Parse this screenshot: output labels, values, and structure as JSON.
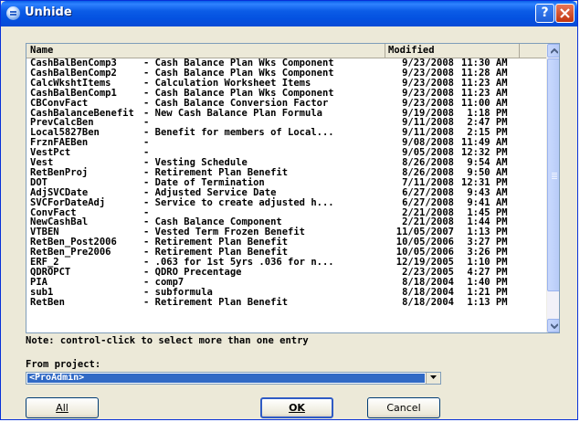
{
  "window": {
    "title": "Unhide",
    "help_label": "?",
    "close_label": "X"
  },
  "table": {
    "columns": [
      "Name",
      "Modified"
    ],
    "rows": [
      {
        "name": "CashBalBenComp3",
        "desc": "- Cash Balance Plan Wks Component",
        "date": "9/23/2008",
        "time": "11:30 AM"
      },
      {
        "name": "CashBalBenComp2",
        "desc": "- Cash Balance Plan Wks Component",
        "date": "9/23/2008",
        "time": "11:28 AM"
      },
      {
        "name": "CalcWkshtItems",
        "desc": "- Calculation Worksheet Items",
        "date": "9/23/2008",
        "time": "11:23 AM"
      },
      {
        "name": "CashBalBenComp1",
        "desc": "- Cash Balance Plan Wks Component",
        "date": "9/23/2008",
        "time": "11:23 AM"
      },
      {
        "name": "CBConvFact",
        "desc": "- Cash Balance Conversion Factor",
        "date": "9/23/2008",
        "time": "11:00 AM"
      },
      {
        "name": "CashBalanceBenefit",
        "desc": "- New Cash Balance Plan Formula",
        "date": "9/19/2008",
        "time": " 1:18 PM"
      },
      {
        "name": "PrevCalcBen",
        "desc": "-",
        "date": "9/11/2008",
        "time": " 2:47 PM"
      },
      {
        "name": "Local5827Ben",
        "desc": "- Benefit for members of Local...",
        "date": "9/11/2008",
        "time": " 2:15 PM"
      },
      {
        "name": "FrznFAEBen",
        "desc": "-",
        "date": "9/08/2008",
        "time": "11:49 AM"
      },
      {
        "name": "VestPct",
        "desc": "-",
        "date": "9/05/2008",
        "time": "12:32 PM"
      },
      {
        "name": "Vest",
        "desc": "- Vesting Schedule",
        "date": "8/26/2008",
        "time": " 9:54 AM"
      },
      {
        "name": "RetBenProj",
        "desc": "- Retirement Plan Benefit",
        "date": "8/26/2008",
        "time": " 9:50 AM"
      },
      {
        "name": "DOT",
        "desc": "- Date of Termination",
        "date": "7/11/2008",
        "time": "12:31 PM"
      },
      {
        "name": "AdjSVCDate",
        "desc": "- Adjusted Service Date",
        "date": "6/27/2008",
        "time": " 9:43 AM"
      },
      {
        "name": "SVCForDateAdj",
        "desc": "- Service to create adjusted h...",
        "date": "6/27/2008",
        "time": " 9:41 AM"
      },
      {
        "name": "ConvFact",
        "desc": "-",
        "date": "2/21/2008",
        "time": " 1:45 PM"
      },
      {
        "name": "NewCashBal",
        "desc": "- Cash Balance Component",
        "date": "2/21/2008",
        "time": " 1:44 PM"
      },
      {
        "name": "VTBEN",
        "desc": "- Vested Term Frozen Benefit",
        "date": "11/05/2007",
        "time": " 1:13 PM"
      },
      {
        "name": "RetBen_Post2006",
        "desc": "- Retirement Plan Benefit",
        "date": "10/05/2006",
        "time": " 3:27 PM"
      },
      {
        "name": "RetBen_Pre2006",
        "desc": "- Retirement Plan Benefit",
        "date": "10/05/2006",
        "time": " 3:26 PM"
      },
      {
        "name": "ERF_2",
        "desc": "- .063 for 1st 5yrs .036 for n...",
        "date": "12/19/2005",
        "time": " 1:10 PM"
      },
      {
        "name": "QDROPCT",
        "desc": "- QDRO Precentage",
        "date": "2/23/2005",
        "time": " 4:27 PM"
      },
      {
        "name": "PIA",
        "desc": "- comp7",
        "date": "8/18/2004",
        "time": " 1:40 PM"
      },
      {
        "name": "sub1",
        "desc": "- subformula",
        "date": "8/18/2004",
        "time": " 1:21 PM"
      },
      {
        "name": "RetBen",
        "desc": "- Retirement Plan Benefit",
        "date": "8/18/2004",
        "time": " 1:13 PM"
      }
    ]
  },
  "note": "Note: control-click to select more than one entry",
  "project": {
    "label": "From project:",
    "value": "<ProAdmin>"
  },
  "buttons": {
    "all": "All",
    "ok": "OK",
    "cancel": "Cancel"
  }
}
